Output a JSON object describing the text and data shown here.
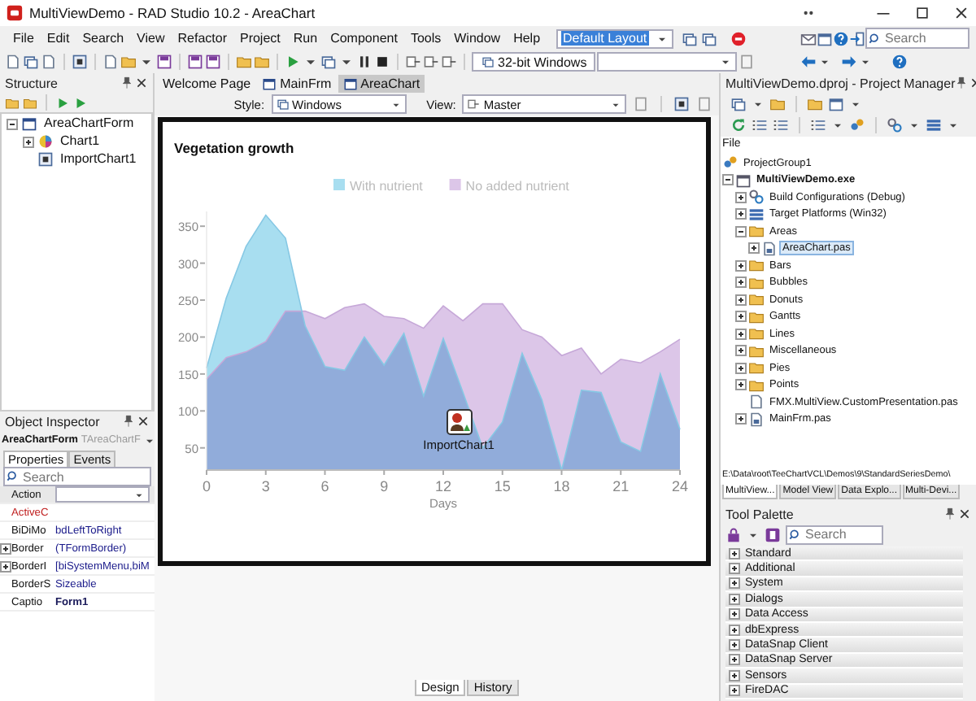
{
  "window": {
    "title": "MultiViewDemo - RAD Studio 10.2 - AreaChart"
  },
  "menu": [
    "File",
    "Edit",
    "Search",
    "View",
    "Refactor",
    "Project",
    "Run",
    "Component",
    "Tools",
    "Window",
    "Help"
  ],
  "layout_combo": {
    "value": "Default Layout"
  },
  "ide_search": {
    "placeholder": "Search"
  },
  "platform_combo": {
    "value": "32-bit Windows"
  },
  "structure": {
    "title": "Structure",
    "tree": [
      {
        "label": "AreaChartForm",
        "kind": "form",
        "expanded": true,
        "children": [
          {
            "label": "Chart1",
            "kind": "chart",
            "expanded": false
          },
          {
            "label": "ImportChart1",
            "kind": "component"
          }
        ]
      }
    ]
  },
  "object_inspector": {
    "title": "Object Inspector",
    "object_name": "AreaChartForm",
    "object_type": "TAreaChartF",
    "tabs": [
      {
        "label": "Properties",
        "selected": true
      },
      {
        "label": "Events",
        "selected": false
      }
    ],
    "search": {
      "placeholder": "Search"
    },
    "properties": [
      {
        "name": "Action",
        "kind": "dropdown"
      },
      {
        "name": "ActiveC",
        "kind": "reference"
      },
      {
        "name": "BiDiMo",
        "value": "bdLeftToRight",
        "kind": "plain"
      },
      {
        "name": "Border",
        "value": "(TFormBorder)",
        "kind": "expandable"
      },
      {
        "name": "BorderI",
        "value": "[biSystemMenu,biM",
        "kind": "expandable"
      },
      {
        "name": "BorderS",
        "value": "Sizeable",
        "kind": "plain"
      },
      {
        "name": "Captio",
        "value": "Form1",
        "kind": "modified"
      }
    ]
  },
  "designer": {
    "tabs": [
      {
        "label": "Welcome Page",
        "selected": false
      },
      {
        "label": "MainFrm",
        "selected": false
      },
      {
        "label": "AreaChart",
        "selected": true
      }
    ],
    "style": {
      "label": "Style:",
      "value": "Windows"
    },
    "view": {
      "label": "View:",
      "value": "Master"
    },
    "chart": {
      "chart_data": {
        "type": "area",
        "title": "Vegetation growth",
        "xlabel": "Days",
        "x": [
          0,
          1,
          2,
          3,
          4,
          5,
          6,
          7,
          8,
          9,
          10,
          11,
          12,
          13,
          14,
          15,
          16,
          17,
          18,
          19,
          20,
          21,
          22,
          23,
          24
        ],
        "series": [
          {
            "name": "With nutrient",
            "color": "#a8def0",
            "values": [
              158,
              253,
              323,
              365,
              334,
              215,
              160,
              155,
              200,
              162,
              205,
              120,
              198,
              125,
              50,
              85,
              178,
              115,
              20,
              128,
              125,
              58,
              45,
              150,
              75
            ]
          },
          {
            "name": "No added nutrient",
            "color": "#dcc6e8",
            "values": [
              143,
              172,
              180,
              194,
              235,
              235,
              225,
              240,
              245,
              228,
              225,
              212,
              242,
              222,
              245,
              245,
              210,
              200,
              175,
              185,
              150,
              170,
              165,
              180,
              197
            ]
          }
        ],
        "legend": "top",
        "xlim": [
          0,
          24
        ],
        "ylim": [
          20,
          370
        ],
        "xticks": [
          0,
          3,
          6,
          9,
          12,
          15,
          18,
          21,
          24
        ],
        "yticks": [
          50,
          100,
          150,
          200,
          250,
          300,
          350
        ]
      },
      "component_label": "ImportChart1"
    },
    "bottom_tabs": [
      {
        "label": "Design",
        "selected": true
      },
      {
        "label": "History",
        "selected": false
      }
    ]
  },
  "project_manager": {
    "title": "MultiViewDemo.dproj - Project Manager",
    "column": "File",
    "tree": [
      {
        "label": "ProjectGroup1",
        "kind": "group",
        "selected": false,
        "children": [
          {
            "label": "MultiViewDemo.exe",
            "kind": "project",
            "expanded": true,
            "selected": false,
            "children": [
              {
                "label": "Build Configurations (Debug)",
                "kind": "config",
                "expanded": false,
                "selected": false
              },
              {
                "label": "Target Platforms (Win32)",
                "kind": "platforms",
                "expanded": false,
                "selected": false
              },
              {
                "label": "Areas",
                "kind": "folder",
                "expanded": true,
                "selected": false,
                "children": [
                  {
                    "label": "AreaChart.pas",
                    "kind": "unit",
                    "expanded": false,
                    "selected": true
                  }
                ]
              },
              {
                "label": "Bars",
                "kind": "folder",
                "expanded": false,
                "selected": false
              },
              {
                "label": "Bubbles",
                "kind": "folder",
                "expanded": false,
                "selected": false
              },
              {
                "label": "Donuts",
                "kind": "folder",
                "expanded": false,
                "selected": false
              },
              {
                "label": "Gantts",
                "kind": "folder",
                "expanded": false,
                "selected": false
              },
              {
                "label": "Lines",
                "kind": "folder",
                "expanded": false,
                "selected": false
              },
              {
                "label": "Miscellaneous",
                "kind": "folder",
                "expanded": false,
                "selected": false
              },
              {
                "label": "Pies",
                "kind": "folder",
                "expanded": false,
                "selected": false
              },
              {
                "label": "Points",
                "kind": "folder",
                "expanded": false,
                "selected": false
              },
              {
                "label": "FMX.MultiView.CustomPresentation.pas",
                "kind": "file",
                "selected": false
              },
              {
                "label": "MainFrm.pas",
                "kind": "unit",
                "expanded": false,
                "selected": false
              }
            ]
          }
        ]
      }
    ],
    "path": "E:\\Data\\root\\TeeChartVCL\\Demos\\9\\StandardSeriesDemo\\",
    "tabs": [
      {
        "label": "MultiView...",
        "selected": true
      },
      {
        "label": "Model View",
        "selected": false
      },
      {
        "label": "Data Explo...",
        "selected": false
      },
      {
        "label": "Multi-Devi...",
        "selected": false
      }
    ]
  },
  "tool_palette": {
    "title": "Tool Palette",
    "search": {
      "placeholder": "Search"
    },
    "categories": [
      "Standard",
      "Additional",
      "System",
      "Dialogs",
      "Data Access",
      "dbExpress",
      "DataSnap Client",
      "DataSnap Server",
      "Sensors",
      "FireDAC"
    ]
  }
}
